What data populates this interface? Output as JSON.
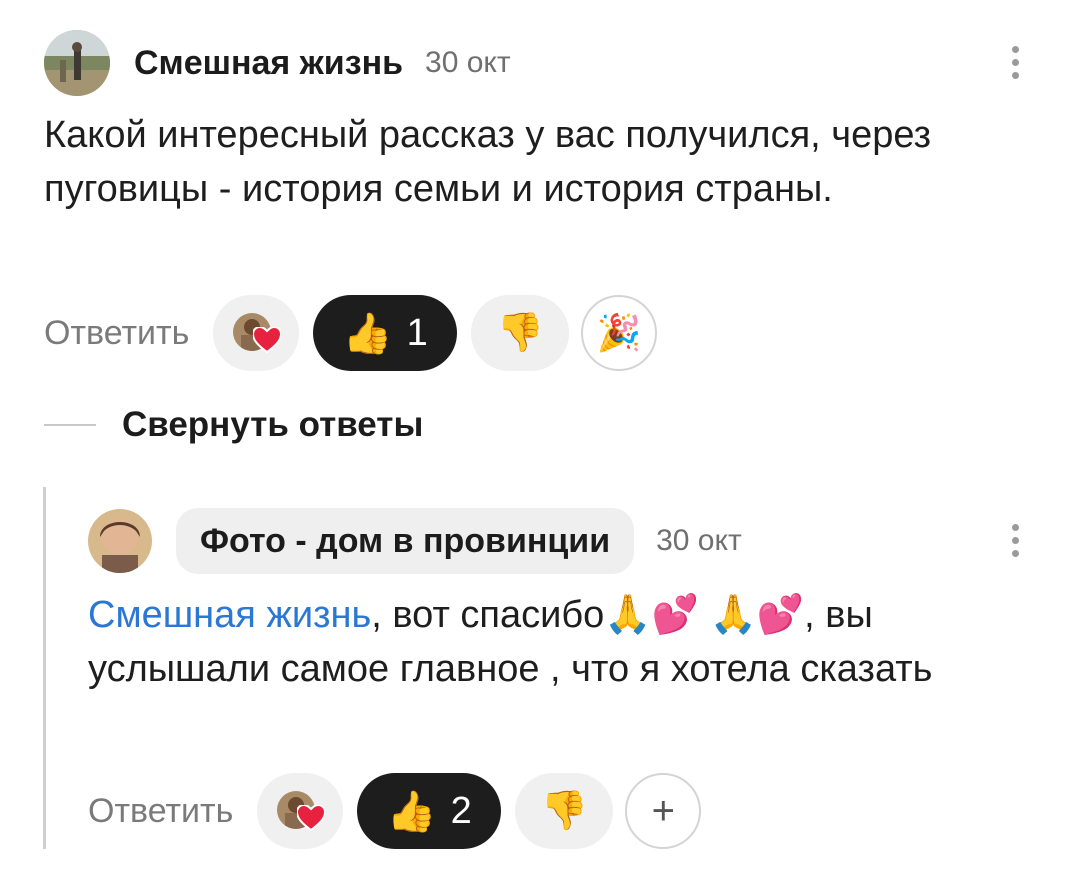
{
  "comment": {
    "author": "Смешная жизнь",
    "date": "30 окт",
    "text": "Какой интересный рассказ у вас получился, через пуговицы - история семьи и история страны.",
    "reply_label": "Ответить",
    "like_count": "1",
    "icons": [
      "avatar-photo",
      "heart-icon",
      "thumbs-up-emoji",
      "thumbs-down-emoji",
      "party-popper-emoji",
      "more-vertical-icon"
    ]
  },
  "collapse_label": "Свернуть ответы",
  "reply": {
    "author": "Фото - дом в провинции",
    "date": "30 окт",
    "mention": "Смешная жизнь",
    "text_line1": ", вот спасибо",
    "emoji_pray": "🙏",
    "emoji_hearts": "💕",
    "text_after_emoji": ", вы",
    "text_rest": "услышали самое главное , что я хотела сказать",
    "reply_label": "Ответить",
    "like_count": "2",
    "add_reaction": "+"
  },
  "colors": {
    "mention": "#2a77d4",
    "dark_pill": "#1d1d1d",
    "grey_pill": "#f0f0f0"
  }
}
